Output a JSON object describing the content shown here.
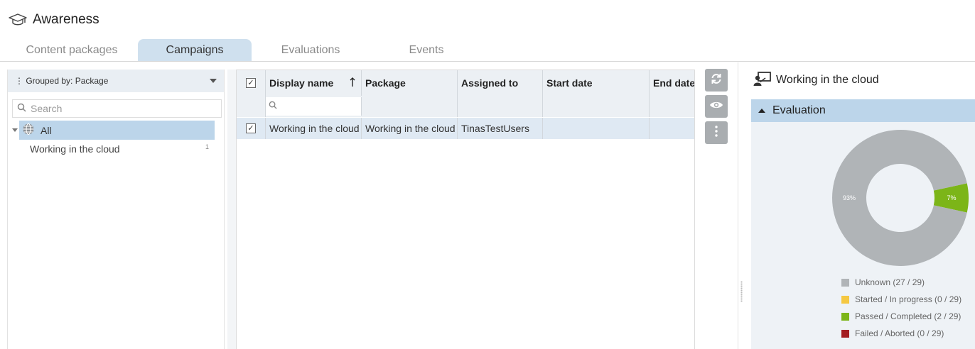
{
  "header": {
    "title": "Awareness",
    "icon": "graduation-cap-icon"
  },
  "tabs": [
    {
      "label": "Content packages",
      "active": false
    },
    {
      "label": "Campaigns",
      "active": true
    },
    {
      "label": "Evaluations",
      "active": false
    },
    {
      "label": "Events",
      "active": false
    }
  ],
  "left_panel": {
    "group_by": "⋮ Grouped by: Package",
    "search_placeholder": "Search",
    "tree": {
      "all_label": "All",
      "items": [
        {
          "label": "Working in the cloud",
          "count": "1"
        }
      ]
    }
  },
  "grid": {
    "columns": [
      "Display name",
      "Package",
      "Assigned to",
      "Start date",
      "End date"
    ],
    "sort": {
      "column": "Display name",
      "direction": "ascending"
    },
    "rows": [
      {
        "selected": true,
        "display_name": "Working in the cloud",
        "package": "Working in the cloud",
        "assigned_to": "TinasTestUsers",
        "start_date": "",
        "end_date": ""
      }
    ]
  },
  "actions": [
    {
      "name": "refresh",
      "icon": "refresh-icon"
    },
    {
      "name": "view",
      "icon": "eye-icon"
    },
    {
      "name": "more",
      "icon": "more-vertical-icon"
    }
  ],
  "detail": {
    "title": "Working in the cloud",
    "icon": "presentation-user-icon",
    "section_title": "Evaluation",
    "chart_data": {
      "type": "pie",
      "donut": true,
      "slices": [
        {
          "label": "Unknown",
          "value": 27,
          "percent_label": "93%",
          "color": "#b0b4b7"
        },
        {
          "label": "Started / In progress",
          "value": 0,
          "percent_label": "",
          "color": "#f5c842"
        },
        {
          "label": "Passed / Completed",
          "value": 2,
          "percent_label": "7%",
          "color": "#7cb518"
        },
        {
          "label": "Failed / Aborted",
          "value": 0,
          "percent_label": "",
          "color": "#a31e22"
        }
      ],
      "total": 29
    },
    "legend": [
      {
        "label": "Unknown  (27 / 29)",
        "color": "#b0b4b7"
      },
      {
        "label": "Started / In progress (0 / 29)",
        "color": "#f5c842"
      },
      {
        "label": "Passed / Completed (2 / 29)",
        "color": "#7cb518"
      },
      {
        "label": "Failed / Aborted (0 / 29)",
        "color": "#a31e22"
      }
    ]
  }
}
